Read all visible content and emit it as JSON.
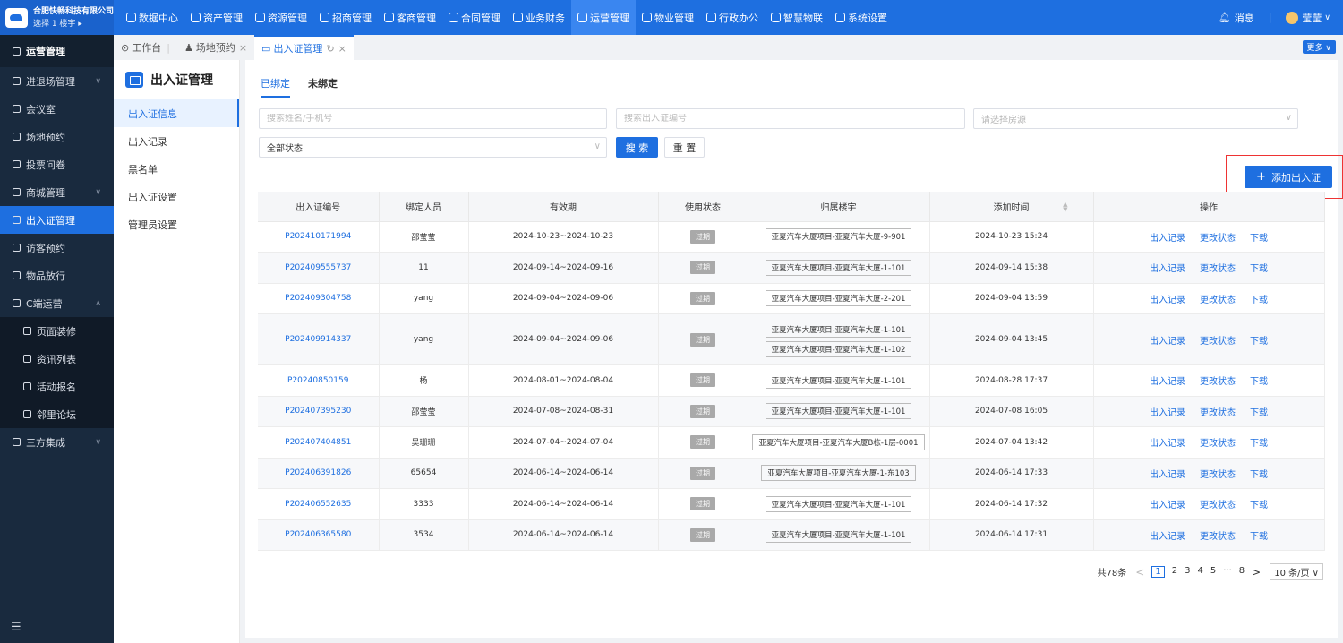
{
  "brand": {
    "company": "合肥快畅科技有限公司",
    "floor": "选择 1 楼宇 ▸"
  },
  "topnav": [
    "数据中心",
    "资产管理",
    "资源管理",
    "招商管理",
    "客商管理",
    "合同管理",
    "业务财务",
    "运营管理",
    "物业管理",
    "行政办公",
    "智慧物联",
    "系统设置"
  ],
  "topnav_active": "运营管理",
  "topright": {
    "message": "消息",
    "sep": "|",
    "user": "莹莹"
  },
  "sidebar": {
    "head": "运营管理",
    "items": [
      "进退场管理",
      "会议室",
      "场地预约",
      "投票问卷",
      "商城管理",
      "出入证管理",
      "访客预约",
      "物品放行",
      "C端运营",
      "页面装修",
      "资讯列表",
      "活动报名",
      "邻里论坛",
      "三方集成"
    ],
    "bottom_icon": "☰"
  },
  "tabs": [
    {
      "label": "工作台"
    },
    {
      "label": "场地预约"
    },
    {
      "label": "出入证管理"
    }
  ],
  "more_label": "更多 ∨",
  "subpanel": {
    "title": "出入证管理",
    "items": [
      "出入证信息",
      "出入记录",
      "黑名单",
      "出入证设置",
      "管理员设置"
    ]
  },
  "inner_tabs": [
    "已绑定",
    "未绑定"
  ],
  "filters": {
    "name_placeholder": "搜索姓名/手机号",
    "code_placeholder": "搜索出入证编号",
    "room_placeholder": "请选择房源",
    "status_value": "全部状态"
  },
  "buttons": {
    "search": "搜 索",
    "reset": "重 置",
    "add": "添加出入证",
    "add_icon": "+"
  },
  "table": {
    "headers": [
      "出入证编号",
      "绑定人员",
      "有效期",
      "使用状态",
      "归属楼宇",
      "添加时间",
      "操作"
    ],
    "ops": [
      "出入记录",
      "更改状态",
      "下载"
    ],
    "rows": [
      {
        "code": "P202410171994",
        "person": "邵莹莹",
        "period": "2024-10-23~2024-10-23",
        "status": "过期",
        "buildings": [
          "亚夏汽车大厦项目-亚夏汽车大厦-9-901"
        ],
        "added": "2024-10-23 15:24"
      },
      {
        "code": "P202409555737",
        "person": "11",
        "period": "2024-09-14~2024-09-16",
        "status": "过期",
        "buildings": [
          "亚夏汽车大厦项目-亚夏汽车大厦-1-101"
        ],
        "added": "2024-09-14 15:38"
      },
      {
        "code": "P202409304758",
        "person": "yang",
        "period": "2024-09-04~2024-09-06",
        "status": "过期",
        "buildings": [
          "亚夏汽车大厦项目-亚夏汽车大厦-2-201"
        ],
        "added": "2024-09-04 13:59"
      },
      {
        "code": "P202409914337",
        "person": "yang",
        "period": "2024-09-04~2024-09-06",
        "status": "过期",
        "buildings": [
          "亚夏汽车大厦项目-亚夏汽车大厦-1-101",
          "亚夏汽车大厦项目-亚夏汽车大厦-1-102"
        ],
        "added": "2024-09-04 13:45"
      },
      {
        "code": "P20240850159",
        "person": "杨",
        "period": "2024-08-01~2024-08-04",
        "status": "过期",
        "buildings": [
          "亚夏汽车大厦项目-亚夏汽车大厦-1-101"
        ],
        "added": "2024-08-28 17:37"
      },
      {
        "code": "P202407395230",
        "person": "邵莹莹",
        "period": "2024-07-08~2024-08-31",
        "status": "过期",
        "buildings": [
          "亚夏汽车大厦项目-亚夏汽车大厦-1-101"
        ],
        "added": "2024-07-08 16:05"
      },
      {
        "code": "P202407404851",
        "person": "吴珊珊",
        "period": "2024-07-04~2024-07-04",
        "status": "过期",
        "buildings": [
          "亚夏汽车大厦项目-亚夏汽车大厦B栋-1层-0001"
        ],
        "added": "2024-07-04 13:42"
      },
      {
        "code": "P202406391826",
        "person": "65654",
        "period": "2024-06-14~2024-06-14",
        "status": "过期",
        "buildings": [
          "亚夏汽车大厦项目-亚夏汽车大厦-1-东103"
        ],
        "added": "2024-06-14 17:33"
      },
      {
        "code": "P202406552635",
        "person": "3333",
        "period": "2024-06-14~2024-06-14",
        "status": "过期",
        "buildings": [
          "亚夏汽车大厦项目-亚夏汽车大厦-1-101"
        ],
        "added": "2024-06-14 17:32"
      },
      {
        "code": "P202406365580",
        "person": "3534",
        "period": "2024-06-14~2024-06-14",
        "status": "过期",
        "buildings": [
          "亚夏汽车大厦项目-亚夏汽车大厦-1-101"
        ],
        "added": "2024-06-14 17:31"
      }
    ]
  },
  "pagination": {
    "total": "共78条",
    "pages": [
      "1",
      "2",
      "3",
      "4",
      "5",
      "···",
      "8"
    ],
    "current": "1",
    "page_size": "10 条/页 ∨"
  },
  "colors": {
    "primary": "#1e6fe0",
    "sidebar": "#192a3e",
    "highlight": "#e33"
  }
}
